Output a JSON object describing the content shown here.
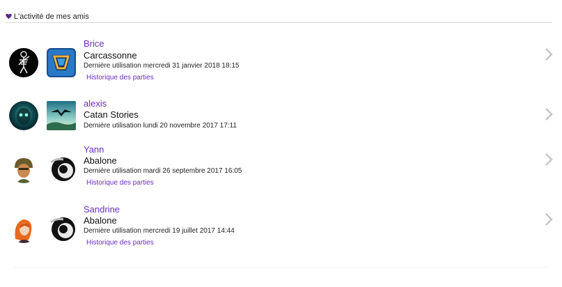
{
  "section": {
    "title": "L'activité de mes amis",
    "icon": "heart-icon",
    "color": "#5a2a86"
  },
  "accent_color": "#6a2fb8",
  "friends": [
    {
      "name": "Brice",
      "game": "Carcassonne",
      "last_used": "Dernière utilisation mercredi 31 janvier 2018 18:15",
      "history_link": "Historique des parties",
      "avatar_icon": "skeleton-avatar-icon",
      "game_icon": "carcassonne-game-icon"
    },
    {
      "name": "alexis",
      "game": "Catan Stories",
      "last_used": "Dernière utilisation lundi 20 novembre 2017 17:11",
      "avatar_icon": "ghost-mask-avatar-icon",
      "game_icon": "catan-stories-game-icon"
    },
    {
      "name": "Yann",
      "game": "Abalone",
      "last_used": "Dernière utilisation mardi 26 septembre 2017 16:05",
      "history_link": "Historique des parties",
      "avatar_icon": "soldier-avatar-icon",
      "game_icon": "abalone-game-icon"
    },
    {
      "name": "Sandrine",
      "game": "Abalone",
      "last_used": "Dernière utilisation mercredi 19 juillet 2017 14:44",
      "history_link": "Historique des parties",
      "avatar_icon": "red-hair-avatar-icon",
      "game_icon": "abalone-game-icon"
    }
  ]
}
